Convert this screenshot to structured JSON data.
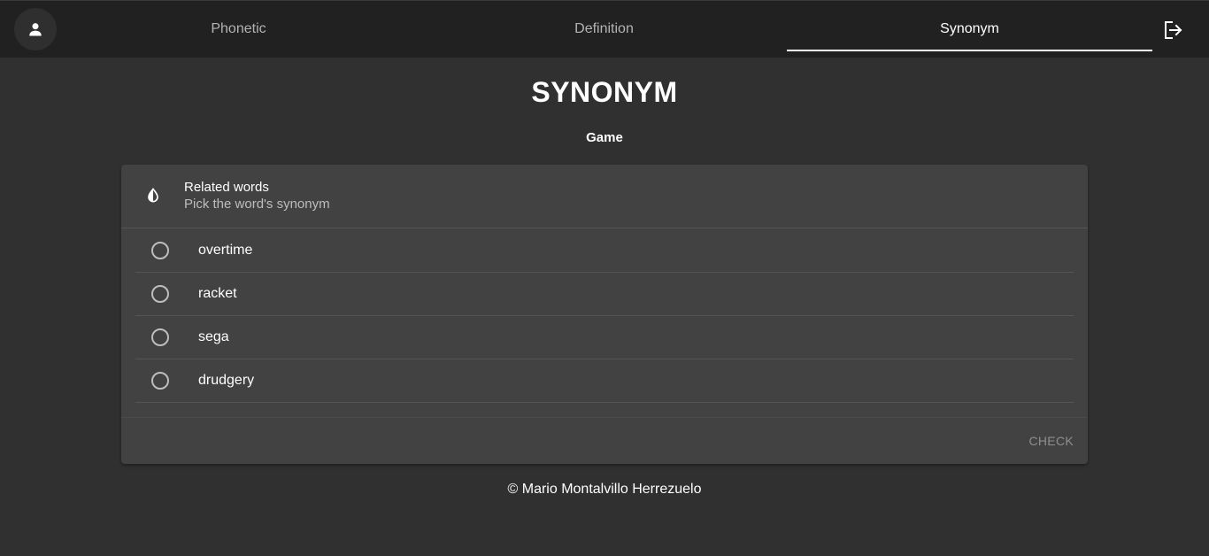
{
  "nav": {
    "tabs": [
      {
        "label": "Phonetic",
        "active": false
      },
      {
        "label": "Definition",
        "active": false
      },
      {
        "label": "Synonym",
        "active": true
      }
    ],
    "avatar_icon": "account-icon",
    "logout_icon": "logout-icon"
  },
  "page": {
    "title": "SYNONYM",
    "word": "Game"
  },
  "card": {
    "icon": "invert-colors-icon",
    "title": "Related words",
    "subtitle": "Pick the word's synonym",
    "options": [
      "overtime",
      "racket",
      "sega",
      "drudgery"
    ],
    "check_label": "CHECK"
  },
  "footer": {
    "text": "© Mario Montalvillo Herrezuelo"
  },
  "colors": {
    "background": "#303030",
    "topbar": "#212121",
    "card": "#424242",
    "text": "#ffffff",
    "muted": "#b3b3b3"
  }
}
